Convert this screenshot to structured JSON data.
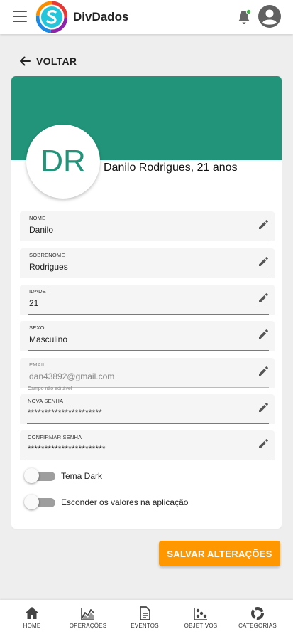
{
  "app": {
    "brand": "DivDados",
    "colors": {
      "header": "#219479",
      "accent": "#ff9800",
      "badge": "#4caf50"
    }
  },
  "back": {
    "label": "VOLTAR"
  },
  "profile": {
    "initials": "DR",
    "display": "Danilo Rodrigues, 21 anos"
  },
  "fields": [
    {
      "label": "NOME",
      "value": "Danilo"
    },
    {
      "label": "SOBRENOME",
      "value": "Rodrigues"
    },
    {
      "label": "IDADE",
      "value": "21"
    },
    {
      "label": "SEXO",
      "value": "Masculino"
    },
    {
      "label": "EMAIL",
      "value": "dan43892@gmail.com",
      "helper": "Campo não editável",
      "disabled": true
    },
    {
      "label": "NOVA SENHA",
      "value": "**********************"
    },
    {
      "label": "CONFIRMAR SENHA",
      "value": "***********************"
    }
  ],
  "toggles": [
    {
      "label": "Tema Dark",
      "on": false
    },
    {
      "label": "Esconder os valores na aplicação",
      "on": false
    }
  ],
  "save_label": "SALVAR ALTERAÇÕES",
  "nav": [
    {
      "label": "HOME",
      "icon": "home-icon"
    },
    {
      "label": "OPERAÇÕES",
      "icon": "chart-line-icon"
    },
    {
      "label": "EVENTOS",
      "icon": "document-icon"
    },
    {
      "label": "OBJETIVOS",
      "icon": "scatter-icon"
    },
    {
      "label": "CATEGORIAS",
      "icon": "donut-icon"
    }
  ]
}
